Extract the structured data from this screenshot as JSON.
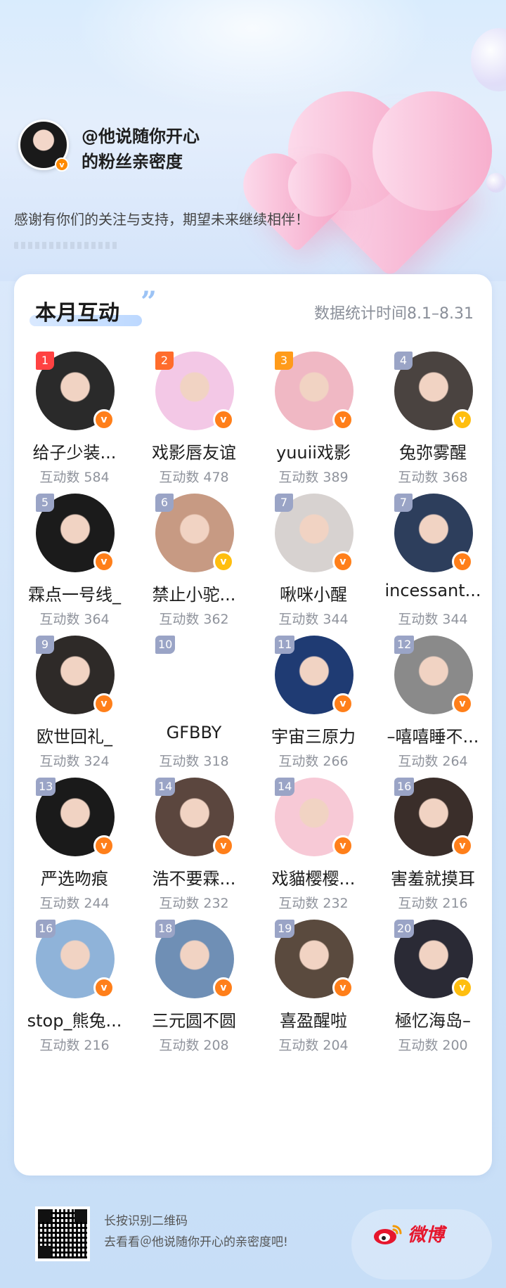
{
  "owner": {
    "title_line1": "@他说随你开心",
    "title_line2": "的粉丝亲密度",
    "badge": "v"
  },
  "thanks_text": "感谢有你们的关注与支持，期望未来继续相伴！",
  "section": {
    "title": "本月互动",
    "date_range": "数据统计时间8.1–8.31"
  },
  "fans": [
    {
      "rank": "1",
      "name": "给子少装...",
      "count": "互动数 584",
      "avatar_color": "#2a2a2a",
      "badge_color": "orange"
    },
    {
      "rank": "2",
      "name": "戏影唇友谊",
      "count": "互动数 478",
      "avatar_color": "#f3c8e6",
      "badge_color": "orange"
    },
    {
      "rank": "3",
      "name": "yuuii戏影",
      "count": "互动数 389",
      "avatar_color": "#f0b8c4",
      "badge_color": "orange"
    },
    {
      "rank": "4",
      "name": "兔弥雾醒",
      "count": "互动数 368",
      "avatar_color": "#4a4340",
      "badge_color": "gold"
    },
    {
      "rank": "5",
      "name": "霖点一号线_",
      "count": "互动数 364",
      "avatar_color": "#1b1b1b",
      "badge_color": "orange"
    },
    {
      "rank": "6",
      "name": "禁止小驼...",
      "count": "互动数 362",
      "avatar_color": "#c79a83",
      "badge_color": "gold"
    },
    {
      "rank": "7",
      "name": "啾咪小醒",
      "count": "互动数 344",
      "avatar_color": "#d7d2d0",
      "badge_color": "orange"
    },
    {
      "rank": "7",
      "name": "incessant...",
      "count": "互动数 344",
      "avatar_color": "#2d3e5c",
      "badge_color": "orange"
    },
    {
      "rank": "9",
      "name": "欧世回礼_",
      "count": "互动数 324",
      "avatar_color": "#2e2a28",
      "badge_color": "orange"
    },
    {
      "rank": "10",
      "name": "GFBBY",
      "count": "互动数 318",
      "avatar_color": "#ffffff",
      "badge_color": "none"
    },
    {
      "rank": "11",
      "name": "宇宙三原力",
      "count": "互动数 266",
      "avatar_color": "#1f3b73",
      "badge_color": "orange"
    },
    {
      "rank": "12",
      "name": "–嘻嘻睡不...",
      "count": "互动数 264",
      "avatar_color": "#8a8a8a",
      "badge_color": "orange"
    },
    {
      "rank": "13",
      "name": "严选吻痕",
      "count": "互动数 244",
      "avatar_color": "#1a1a1a",
      "badge_color": "orange"
    },
    {
      "rank": "14",
      "name": "浩不要霖...",
      "count": "互动数 232",
      "avatar_color": "#5b463e",
      "badge_color": "orange"
    },
    {
      "rank": "14",
      "name": "戏貓樱樱...",
      "count": "互动数 232",
      "avatar_color": "#f7c9d6",
      "badge_color": "orange"
    },
    {
      "rank": "16",
      "name": "害羞就摸耳",
      "count": "互动数 216",
      "avatar_color": "#3a2e2a",
      "badge_color": "orange"
    },
    {
      "rank": "16",
      "name": "stop_熊兔...",
      "count": "互动数 216",
      "avatar_color": "#8fb3d9",
      "badge_color": "orange"
    },
    {
      "rank": "18",
      "name": "三元圆不圆",
      "count": "互动数 208",
      "avatar_color": "#6f8fb5",
      "badge_color": "orange"
    },
    {
      "rank": "19",
      "name": "喜盈醒啦",
      "count": "互动数 204",
      "avatar_color": "#5a4a3e",
      "badge_color": "orange"
    },
    {
      "rank": "20",
      "name": "極忆海岛–",
      "count": "互动数 200",
      "avatar_color": "#2a2a35",
      "badge_color": "gold"
    }
  ],
  "footer": {
    "line1": "长按识别二维码",
    "line2": "去看看＠他说随你开心的亲密度吧!",
    "brand": "微博",
    "qr_icon": "qr-code"
  },
  "colors": {
    "badge_orange": "#ff7f1a",
    "badge_gold": "#ffbe0f",
    "rank1": "#ff4242",
    "rank2": "#ff6c2c",
    "rank3": "#ff9b1a",
    "rank_other": "#9aa4c6",
    "brand_red": "#e6162d"
  }
}
